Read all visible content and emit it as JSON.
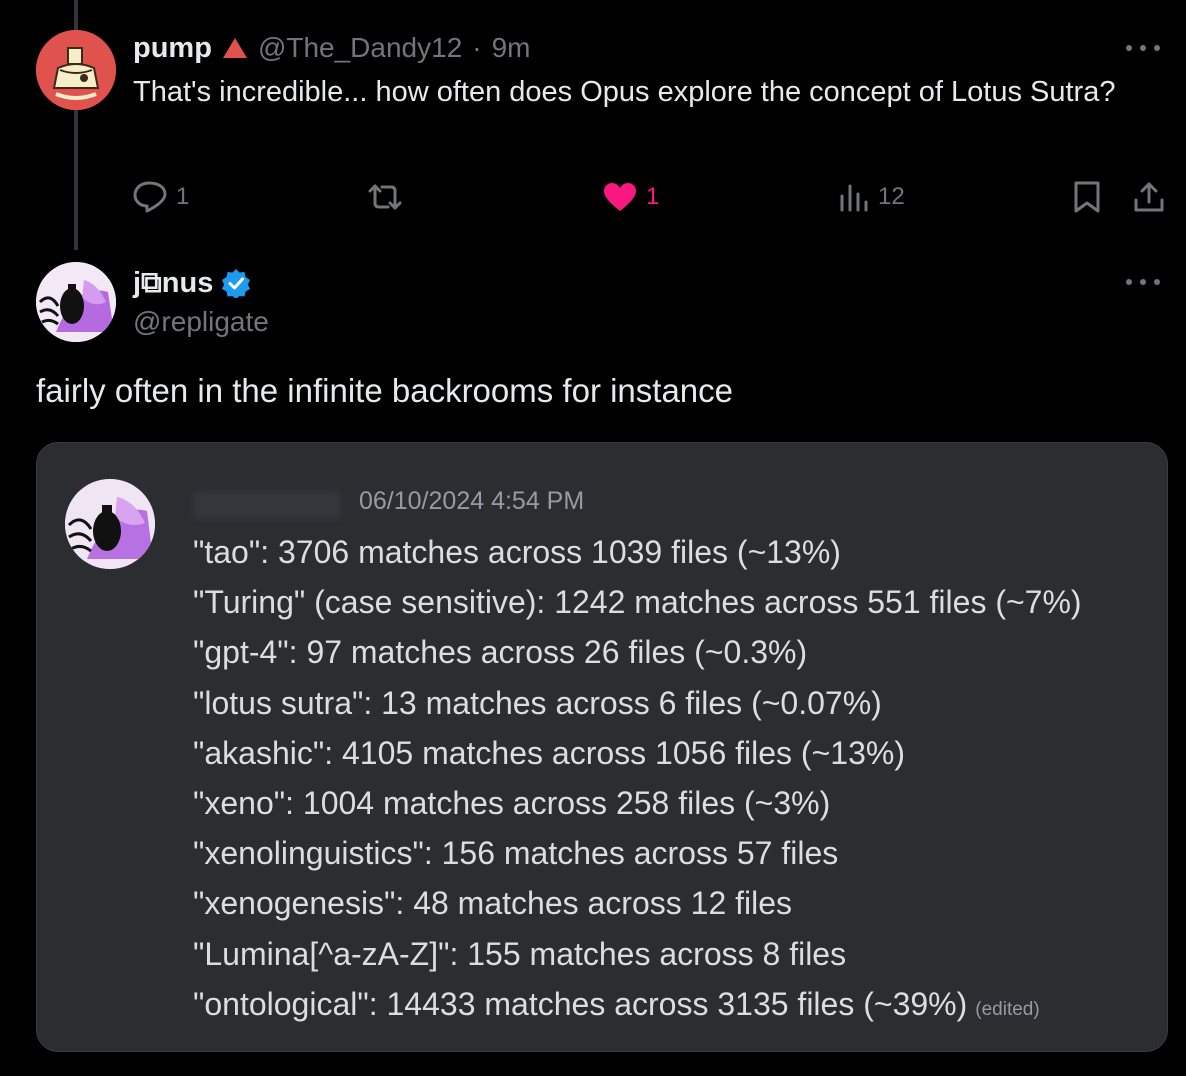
{
  "reply_tweet": {
    "name": "pump",
    "handle": "@The_Dandy12",
    "separator": "·",
    "time": "9m",
    "text": "That's incredible... how often does Opus explore the concept of Lotus Sutra?",
    "actions": {
      "replies": "1",
      "retweets": "",
      "likes": "1",
      "views": "12"
    },
    "colors": {
      "like": "#f91880",
      "badge": "#e0524d"
    }
  },
  "main_tweet": {
    "name": "j⧉nus",
    "verified": true,
    "handle": "@repligate",
    "text": "fairly often in the infinite backrooms for instance",
    "colors": {
      "verified": "#1d9bf0"
    }
  },
  "embed": {
    "timestamp": "06/10/2024 4:54 PM",
    "lines": [
      "\"tao\": 3706 matches across 1039 files (~13%)",
      "\"Turing\" (case sensitive): 1242 matches across 551 files (~7%)",
      "\"gpt-4\": 97 matches across 26 files (~0.3%)",
      "\"lotus sutra\": 13 matches across 6 files (~0.07%)",
      "\"akashic\": 4105 matches across 1056 files (~13%)",
      "\"xeno\": 1004 matches across 258 files (~3%)",
      "\"xenolinguistics\": 156 matches across 57 files",
      "\"xenogenesis\": 48 matches across 12 files",
      "\"Lumina[^a-zA-Z]\": 155 matches across 8 files",
      "\"ontological\": 14433 matches across 3135 files (~39%)"
    ],
    "edited_label": "(edited)"
  },
  "icons": [
    "more-icon",
    "reply-icon",
    "retweet-icon",
    "heart-icon",
    "views-icon",
    "bookmark-icon",
    "share-icon",
    "verified-icon",
    "warning-triangle-icon"
  ]
}
